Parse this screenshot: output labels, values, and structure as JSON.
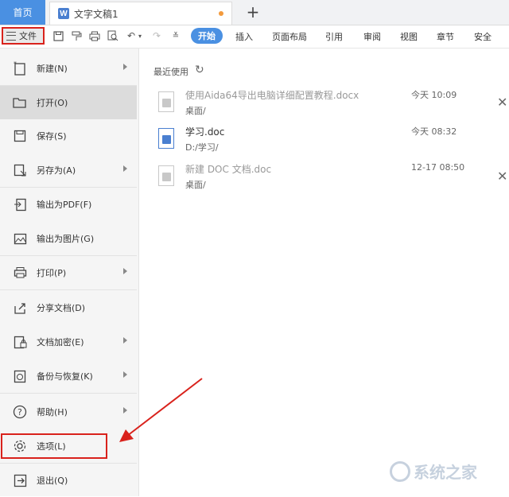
{
  "tabs": {
    "home": "首页",
    "document": "文字文稿1",
    "new_tab_icon": "plus-icon"
  },
  "toolbar": {
    "file_label": "文件",
    "ribbon_tabs": [
      "开始",
      "插入",
      "页面布局",
      "引用",
      "审阅",
      "视图",
      "章节",
      "安全"
    ],
    "active_tab": "开始"
  },
  "menu": {
    "items": [
      {
        "label": "新建(N)",
        "icon": "new-document-icon",
        "submenu": true
      },
      {
        "label": "打开(O)",
        "icon": "folder-open-icon",
        "submenu": false,
        "selected": true
      },
      {
        "label": "保存(S)",
        "icon": "save-icon",
        "submenu": false
      },
      {
        "label": "另存为(A)",
        "icon": "save-as-icon",
        "submenu": true
      },
      {
        "label": "输出为PDF(F)",
        "icon": "export-pdf-icon",
        "submenu": false
      },
      {
        "label": "输出为图片(G)",
        "icon": "export-image-icon",
        "submenu": false
      },
      {
        "label": "打印(P)",
        "icon": "printer-icon",
        "submenu": true
      },
      {
        "label": "分享文档(D)",
        "icon": "share-icon",
        "submenu": false
      },
      {
        "label": "文档加密(E)",
        "icon": "encrypt-icon",
        "submenu": true
      },
      {
        "label": "备份与恢复(K)",
        "icon": "backup-icon",
        "submenu": true
      },
      {
        "label": "帮助(H)",
        "icon": "help-icon",
        "submenu": true
      },
      {
        "label": "选项(L)",
        "icon": "gear-icon",
        "submenu": false
      },
      {
        "label": "退出(Q)",
        "icon": "exit-icon",
        "submenu": false
      }
    ]
  },
  "recent": {
    "header": "最近使用",
    "files": [
      {
        "name": "使用Aida64导出电脑详细配置教程.docx",
        "path": "桌面/",
        "time": "今天 10:09",
        "dim": true,
        "closable": true
      },
      {
        "name": "学习.doc",
        "path": "D:/学习/",
        "time": "今天 08:32",
        "dim": false,
        "closable": false
      },
      {
        "name": "新建 DOC 文档.doc",
        "path": "桌面/",
        "time": "12-17 08:50",
        "dim": true,
        "closable": true
      }
    ]
  },
  "watermark": {
    "text": "系统之家"
  },
  "colors": {
    "accent": "#4a90e2",
    "highlight": "#d9221c"
  }
}
